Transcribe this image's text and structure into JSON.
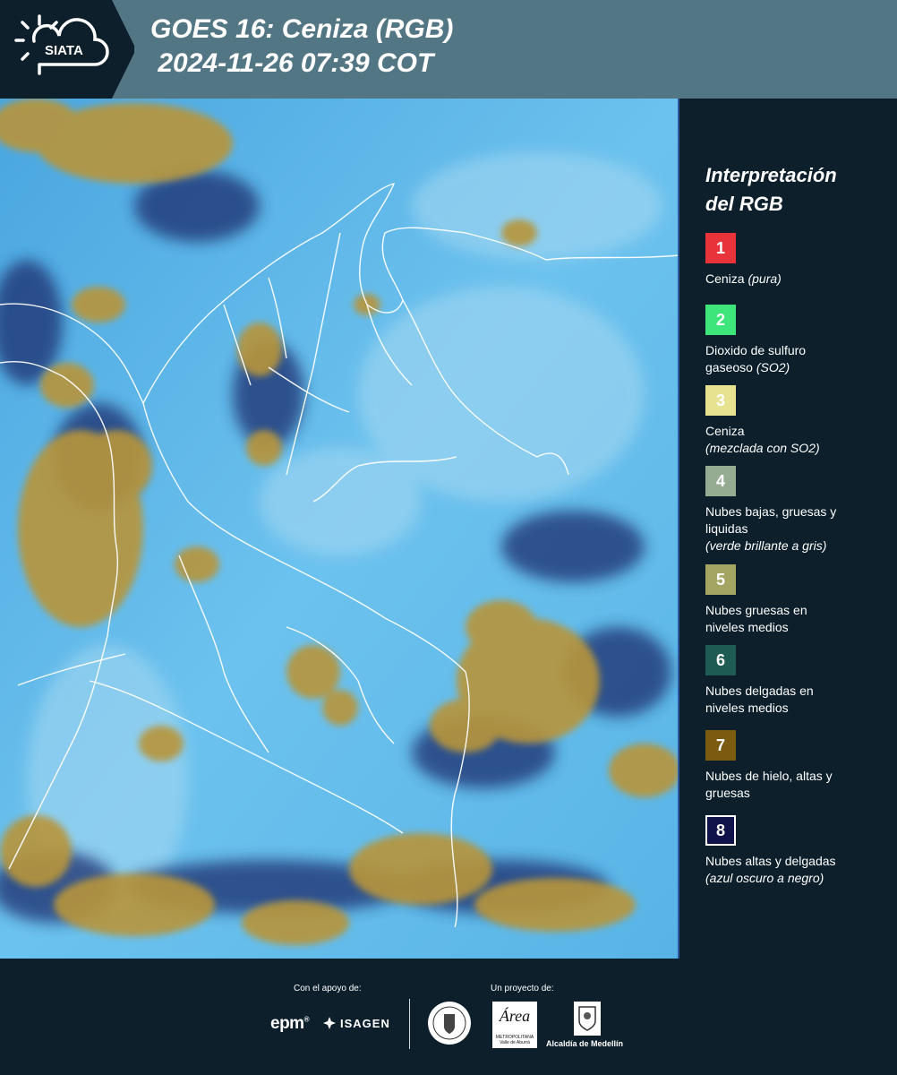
{
  "header": {
    "logo_text": "SIATA",
    "title_line1": "GOES 16: Ceniza (RGB)",
    "title_line2": " 2024-11-26 07:39 COT"
  },
  "legend": {
    "title_line1": "Interpretación",
    "title_line2": "del RGB",
    "items": [
      {
        "number": "1",
        "color": "#e8333a",
        "label_lines": [
          "Ceniza"
        ],
        "italic": "(pura)",
        "italic_inline": true
      },
      {
        "number": "2",
        "color": "#3ee57a",
        "label_lines": [
          "Dioxido de sulfuro",
          "gaseoso"
        ],
        "italic": "(SO2)",
        "italic_inline": true
      },
      {
        "number": "3",
        "color": "#e7e28f",
        "label_lines": [
          "Ceniza"
        ],
        "italic": "(mezclada con SO2)",
        "italic_inline": false
      },
      {
        "number": "4",
        "color": "#95ac93",
        "label_lines": [
          "Nubes bajas, gruesas y",
          "liquidas"
        ],
        "italic": "(verde brillante a gris)",
        "italic_inline": false
      },
      {
        "number": "5",
        "color": "#a4a463",
        "label_lines": [
          "Nubes gruesas en",
          "niveles medios"
        ],
        "italic": "",
        "italic_inline": false
      },
      {
        "number": "6",
        "color": "#1e5b53",
        "label_lines": [
          "Nubes delgadas en",
          "niveles medios"
        ],
        "italic": "",
        "italic_inline": false
      },
      {
        "number": "7",
        "color": "#7b5b0f",
        "label_lines": [
          "Nubes de hielo, altas y",
          "gruesas"
        ],
        "italic": "",
        "italic_inline": false
      },
      {
        "number": "8",
        "color": "#10124a",
        "label_lines": [
          "Nubes altas y delgadas"
        ],
        "italic": "(azul oscuro a negro)",
        "italic_inline": false
      }
    ]
  },
  "footer": {
    "support_label": "Con el apoyo de:",
    "project_label": "Un proyecto de:",
    "epm": "epm",
    "isagen": "ISAGEN",
    "area_title": "Área",
    "area_sub1": "METROPOLITANA",
    "area_sub2": "Valle de Aburrá",
    "alcaldia": "Alcaldía de Medellín"
  },
  "colors": {
    "header_bg": "#527684",
    "logo_bg": "#0c1f2b",
    "page_bg": "#0c1f2b",
    "map_sky_blue": "#5cb8ea",
    "cloud_ochre": "#b8953a",
    "cloud_dark": "#1b2f6e"
  }
}
